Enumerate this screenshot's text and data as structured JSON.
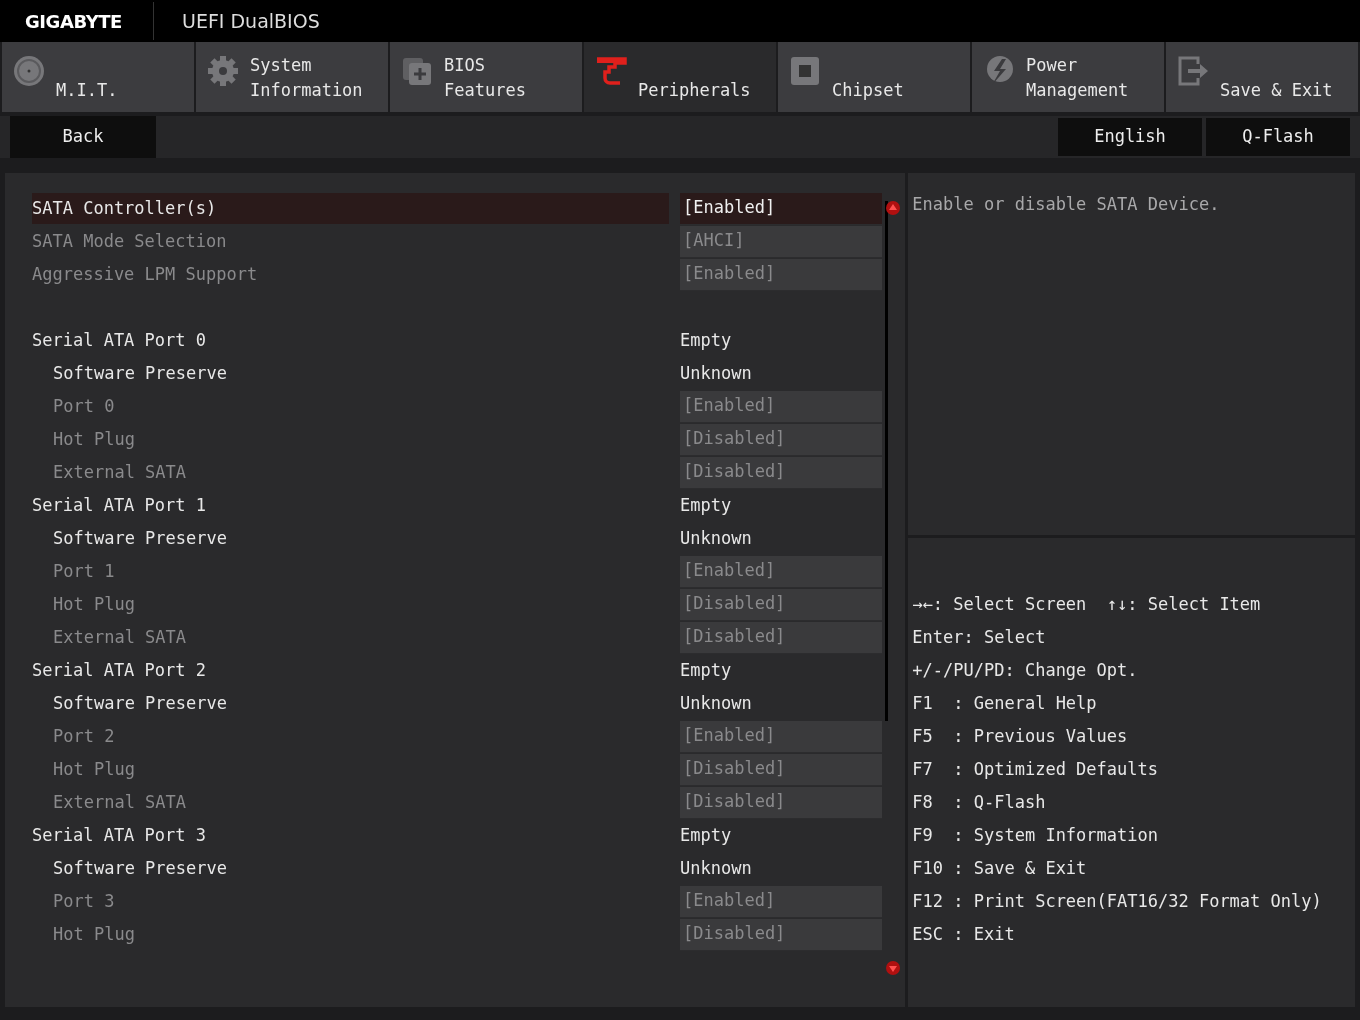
{
  "header": {
    "brand": "GIGABYTE",
    "title": "UEFI DualBIOS"
  },
  "tabs": [
    {
      "label": "M.I.T.",
      "kind": "dial",
      "selected": false
    },
    {
      "label": "System\nInformation",
      "kind": "gear",
      "selected": false
    },
    {
      "label": "BIOS\nFeatures",
      "kind": "chip",
      "selected": false
    },
    {
      "label": "Peripherals",
      "kind": "plug",
      "selected": true
    },
    {
      "label": "Chipset",
      "kind": "board",
      "selected": false
    },
    {
      "label": "Power\nManagement",
      "kind": "bolt",
      "selected": false
    },
    {
      "label": "Save & Exit",
      "kind": "exit",
      "selected": false
    }
  ],
  "toolbar": {
    "back": "Back",
    "buttons": [
      "English",
      "Q-Flash"
    ]
  },
  "sections": [
    {
      "items": [
        {
          "label": "SATA Controller(s)",
          "value": "[Enabled]",
          "kind": "option",
          "disabled": false,
          "selected": true
        },
        {
          "label": "SATA Mode Selection",
          "value": "[AHCI]",
          "kind": "option",
          "disabled": true,
          "selected": false
        },
        {
          "label": "Aggressive LPM Support",
          "value": "[Enabled]",
          "kind": "option",
          "disabled": true,
          "selected": false
        }
      ]
    },
    {
      "items": [
        {
          "label": "Serial ATA Port 0",
          "value": "Empty",
          "kind": "info",
          "disabled": false,
          "selected": false,
          "children": [
            {
              "label": "Software Preserve",
              "value": "Unknown",
              "kind": "info",
              "disabled": false,
              "selected": false
            },
            {
              "label": "Port 0",
              "value": "[Enabled]",
              "kind": "option",
              "disabled": true,
              "selected": false
            },
            {
              "label": "Hot Plug",
              "value": "[Disabled]",
              "kind": "option",
              "disabled": true,
              "selected": false
            },
            {
              "label": "External SATA",
              "value": "[Disabled]",
              "kind": "option",
              "disabled": true,
              "selected": false
            }
          ]
        },
        {
          "label": "Serial ATA Port 1",
          "value": "Empty",
          "kind": "info",
          "disabled": false,
          "selected": false,
          "children": [
            {
              "label": "Software Preserve",
              "value": "Unknown",
              "kind": "info",
              "disabled": false,
              "selected": false
            },
            {
              "label": "Port 1",
              "value": "[Enabled]",
              "kind": "option",
              "disabled": true,
              "selected": false
            },
            {
              "label": "Hot Plug",
              "value": "[Disabled]",
              "kind": "option",
              "disabled": true,
              "selected": false
            },
            {
              "label": "External SATA",
              "value": "[Disabled]",
              "kind": "option",
              "disabled": true,
              "selected": false
            }
          ]
        },
        {
          "label": "Serial ATA Port 2",
          "value": "Empty",
          "kind": "info",
          "disabled": false,
          "selected": false,
          "children": [
            {
              "label": "Software Preserve",
              "value": "Unknown",
              "kind": "info",
              "disabled": false,
              "selected": false
            },
            {
              "label": "Port 2",
              "value": "[Enabled]",
              "kind": "option",
              "disabled": true,
              "selected": false
            },
            {
              "label": "Hot Plug",
              "value": "[Disabled]",
              "kind": "option",
              "disabled": true,
              "selected": false
            },
            {
              "label": "External SATA",
              "value": "[Disabled]",
              "kind": "option",
              "disabled": true,
              "selected": false
            }
          ]
        },
        {
          "label": "Serial ATA Port 3",
          "value": "Empty",
          "kind": "info",
          "disabled": false,
          "selected": false,
          "children": [
            {
              "label": "Software Preserve",
              "value": "Unknown",
              "kind": "info",
              "disabled": false,
              "selected": false
            },
            {
              "label": "Port 3",
              "value": "[Enabled]",
              "kind": "option",
              "disabled": true,
              "selected": false
            },
            {
              "label": "Hot Plug",
              "value": "[Disabled]",
              "kind": "option",
              "disabled": true,
              "selected": false
            }
          ]
        }
      ]
    }
  ],
  "help": {
    "description": "Enable or disable SATA Device.",
    "keys": [
      "→←: Select Screen  ↑↓: Select Item",
      "Enter: Select",
      "+/-/PU/PD: Change Opt.",
      "F1  : General Help",
      "F5  : Previous Values",
      "F7  : Optimized Defaults",
      "F8  : Q-Flash",
      "F9  : System Information",
      "F10 : Save & Exit",
      "F12 : Print Screen(FAT16/32 Format Only)",
      "ESC : Exit"
    ]
  }
}
